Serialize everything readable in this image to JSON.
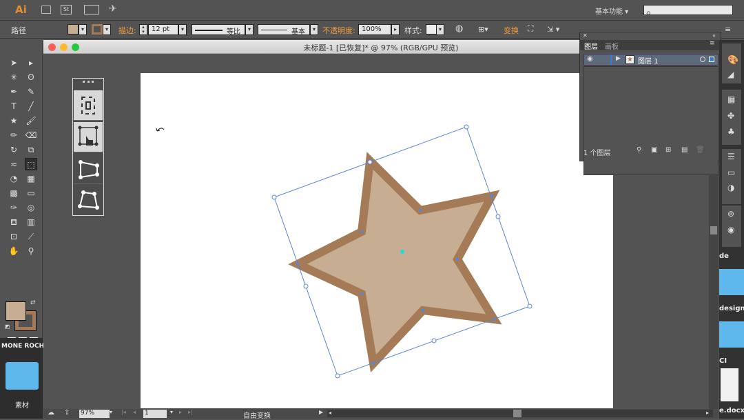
{
  "app": {
    "logo": "Ai",
    "workspace": "基本功能",
    "bridge_label": "St"
  },
  "control_bar": {
    "selection_type": "路径",
    "stroke_label": "描边:",
    "stroke_weight": "12 pt",
    "variable_width_profile": "等比",
    "brush_definition": "基本",
    "opacity_label": "不透明度:",
    "opacity_value": "100%",
    "style_label": "样式:",
    "transform_label": "变换"
  },
  "document": {
    "title": "未标题-1 [已恢复]* @ 97% (RGB/GPU 预览)"
  },
  "layers_panel": {
    "tabs": [
      "图层",
      "画板"
    ],
    "layer_name": "图层 1",
    "layer_count": "1 个图层"
  },
  "status_bar": {
    "zoom": "97%",
    "artboard_number": "1",
    "tool_name": "自由变换"
  },
  "desktop": {
    "left_label_1": "MONE ROCH",
    "left_folder_label": "素材",
    "right_labels": [
      "de",
      "design",
      "CI",
      "e.docx"
    ]
  },
  "colors": {
    "fill": "#c7ad92",
    "stroke": "#a47b56",
    "selection": "#5b84d6",
    "accent": "#f39c3b"
  }
}
